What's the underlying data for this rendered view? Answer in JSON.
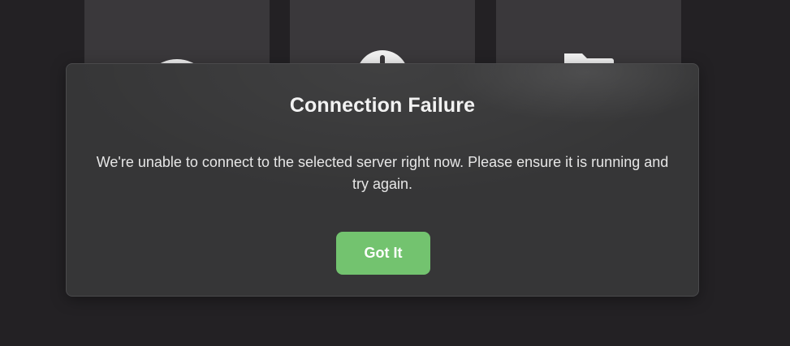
{
  "background": {
    "tiles": [
      {
        "icon": "wifi-icon"
      },
      {
        "icon": "info-icon"
      },
      {
        "icon": "folder-icon"
      }
    ]
  },
  "dialog": {
    "title": "Connection Failure",
    "message": "We're unable to connect to the selected server right now. Please ensure it is running and try again.",
    "button_label": "Got It"
  },
  "colors": {
    "page_background": "#232124",
    "tile_background": "#3a383b",
    "dialog_background": "#363637",
    "button_accent": "#73c36f"
  }
}
